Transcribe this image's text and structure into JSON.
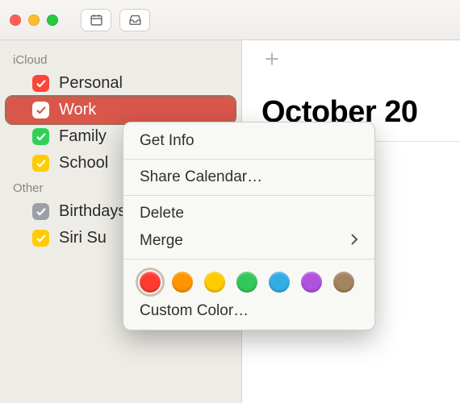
{
  "main": {
    "title": "October 20"
  },
  "sidebar": {
    "sections": [
      {
        "header": "iCloud",
        "items": [
          {
            "label": "Personal",
            "color": "#fd453a",
            "selected": false
          },
          {
            "label": "Work",
            "color": "#ffffff",
            "selected": true
          },
          {
            "label": "Family",
            "color": "#30d158",
            "selected": false
          },
          {
            "label": "School",
            "color": "#ffcc00",
            "selected": false
          }
        ]
      },
      {
        "header": "Other",
        "items": [
          {
            "label": "Birthdays",
            "color": "#9ca0a6",
            "selected": false
          },
          {
            "label": "Siri Su",
            "color": "#ffcc00",
            "selected": false
          }
        ]
      }
    ]
  },
  "contextMenu": {
    "getInfo": "Get Info",
    "share": "Share Calendar…",
    "delete": "Delete",
    "merge": "Merge",
    "customColor": "Custom Color…",
    "colors": [
      "#ff3b30",
      "#ff9500",
      "#ffcc00",
      "#34c759",
      "#32ade6",
      "#af52de",
      "#a2845e"
    ],
    "selectedColorIndex": 0
  }
}
